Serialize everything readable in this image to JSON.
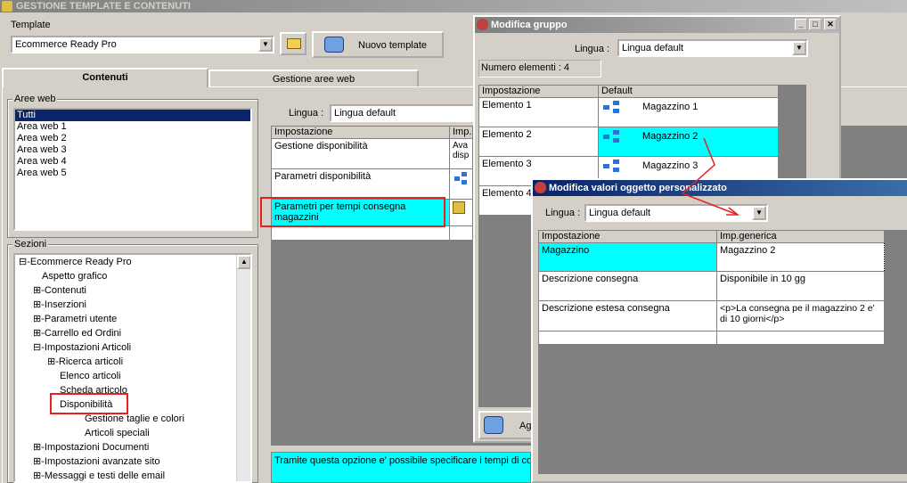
{
  "main": {
    "title": "GESTIONE TEMPLATE E CONTENUTI",
    "template_label": "Template",
    "template_value": "Ecommerce Ready Pro",
    "new_template_button": "Nuovo template",
    "tabs": [
      "Contenuti",
      "Gestione aree web"
    ],
    "aree_web_label": "Aree web",
    "aree_web": [
      "Tutti",
      "Area web 1",
      "Area web 2",
      "Area web 3",
      "Area web 4",
      "Area web 5"
    ],
    "sezioni_label": "Sezioni",
    "tree": [
      {
        "label": "Ecommerce Ready Pro",
        "prefix": "⊟-"
      },
      {
        "label": "Aspetto grafico",
        "prefix": ""
      },
      {
        "label": "Contenuti",
        "prefix": "⊞-"
      },
      {
        "label": "Inserzioni",
        "prefix": "⊞-"
      },
      {
        "label": "Parametri utente",
        "prefix": "⊞-"
      },
      {
        "label": "Carrello ed Ordini",
        "prefix": "⊞-"
      },
      {
        "label": "Impostazioni Articoli",
        "prefix": "⊟-"
      },
      {
        "label": "Ricerca articoli",
        "prefix": "⊞-"
      },
      {
        "label": "Elenco articoli",
        "prefix": ""
      },
      {
        "label": "Scheda articolo",
        "prefix": ""
      },
      {
        "label": "Disponibilità",
        "prefix": ""
      },
      {
        "label": "Gestione taglie e colori",
        "prefix": ""
      },
      {
        "label": "Articoli speciali",
        "prefix": ""
      },
      {
        "label": "Impostazioni Documenti",
        "prefix": "⊞-"
      },
      {
        "label": "Impostazioni avanzate sito",
        "prefix": "⊞-"
      },
      {
        "label": "Messaggi e testi delle email",
        "prefix": "⊞-"
      }
    ],
    "lingua_label": "Lingua :",
    "lingua_value": "Lingua default",
    "grid_headers": [
      "Impostazione",
      "Imp."
    ],
    "grid_rows": [
      {
        "name": "Gestione disponibilità",
        "value": "Ava disp"
      },
      {
        "name": "Parametri disponibilità",
        "value": ""
      },
      {
        "name": "Parametri per tempi consegna magazzini",
        "value": ""
      }
    ],
    "description": "Tramite questa opzione e' possibile specificare i tempi di con"
  },
  "group_window": {
    "title": "Modifica gruppo",
    "lingua_label": "Lingua :",
    "lingua_value": "Lingua default",
    "count_label": "Numero elementi : 4",
    "headers": [
      "Impostazione",
      "Default"
    ],
    "rows": [
      {
        "name": "Elemento 1",
        "value": "Magazzino 1"
      },
      {
        "name": "Elemento 2",
        "value": "Magazzino 2"
      },
      {
        "name": "Elemento 3",
        "value": "Magazzino 3"
      },
      {
        "name": "Elemento 4",
        "value": ""
      }
    ],
    "add_button": "Ag"
  },
  "custom_window": {
    "title": "Modifica valori oggetto personalizzato",
    "lingua_label": "Lingua :",
    "lingua_value": "Lingua default",
    "headers": [
      "Impostazione",
      "Imp.generica"
    ],
    "rows": [
      {
        "name": "Magazzino",
        "value": "Magazzino 2"
      },
      {
        "name": "Descrizione consegna",
        "value": "Disponibile in 10 gg"
      },
      {
        "name": "Descrizione estesa consegna",
        "value": "<p>La consegna pe il magazzino 2 e' di 10 giorni</p>"
      }
    ]
  },
  "colors": {
    "highlight": "#00ffff",
    "annotation": "#e82020",
    "titlebar": "#0a246a"
  }
}
